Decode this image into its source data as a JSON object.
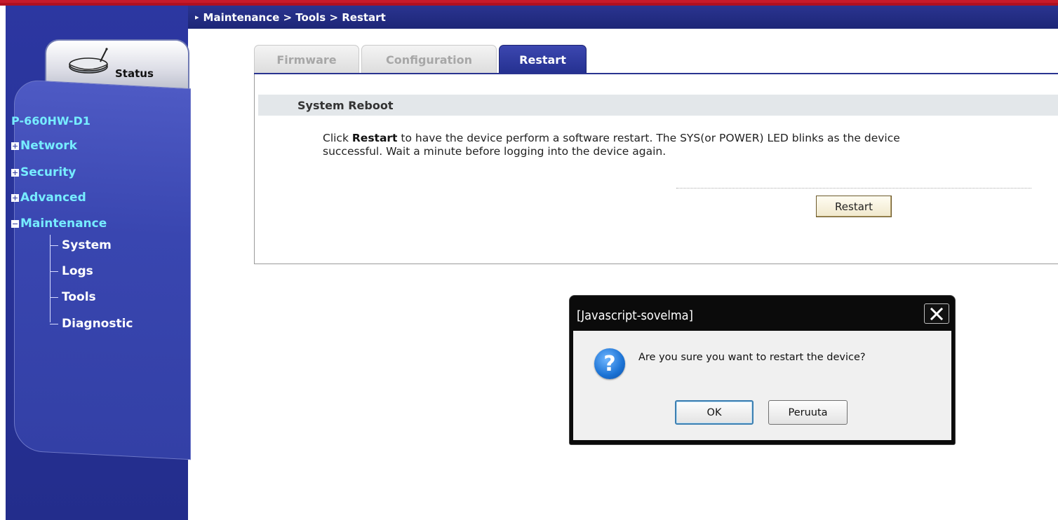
{
  "breadcrumb": "Maintenance > Tools > Restart",
  "sidebar": {
    "status_label": "Status",
    "model": "P-660HW-D1",
    "items": [
      {
        "label": "Network",
        "expanded": false
      },
      {
        "label": "Security",
        "expanded": false
      },
      {
        "label": "Advanced",
        "expanded": false
      },
      {
        "label": "Maintenance",
        "expanded": true
      }
    ],
    "sub_items": [
      "System",
      "Logs",
      "Tools",
      "Diagnostic"
    ]
  },
  "tabs": [
    {
      "label": "Firmware",
      "active": false
    },
    {
      "label": "Configuration",
      "active": false
    },
    {
      "label": "Restart",
      "active": true
    }
  ],
  "section": {
    "title": "System Reboot",
    "desc_pre": "Click ",
    "desc_bold": "Restart",
    "desc_post": " to have the device perform a software restart. The SYS(or POWER) LED blinks as the device",
    "desc_line2": "successful. Wait a minute before logging into the device again.",
    "restart_button": "Restart"
  },
  "dialog": {
    "title": "[Javascript-sovelma]",
    "message": "Are you sure you want to restart the device?",
    "ok": "OK",
    "cancel": "Peruuta",
    "icon": "question-icon"
  },
  "colors": {
    "header_blue": "#1d2677",
    "sidebar_blue": "#2c37a1",
    "nav_text": "#76ecff",
    "top_red": "#b01020"
  }
}
